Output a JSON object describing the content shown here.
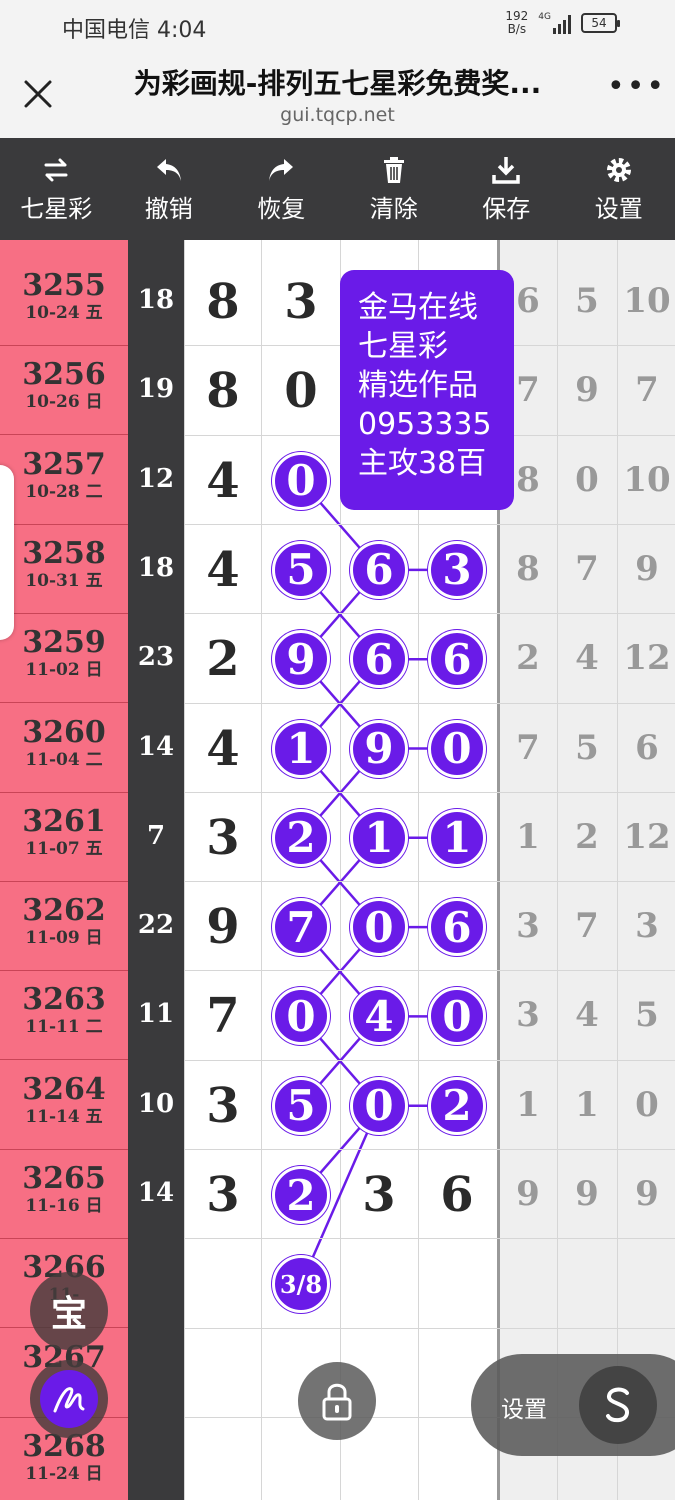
{
  "status_bar": {
    "carrier_time": "中国电信 4:04",
    "net_speed_value": "192",
    "net_speed_unit": "B/s",
    "network": "4G",
    "battery": "54"
  },
  "browser": {
    "title": "为彩画规-排列五七星彩免费奖...",
    "url": "gui.tqcp.net",
    "more": "•••"
  },
  "toolbar": {
    "mode": "七星彩",
    "undo": "撤销",
    "redo": "恢复",
    "clear": "清除",
    "save": "保存",
    "settings": "设置"
  },
  "rows": [
    {
      "issue": "3255",
      "date": "10-24 五",
      "sum": "18",
      "d1": "8",
      "d2": "3",
      "g1": "6",
      "g2": "5",
      "g3": "10"
    },
    {
      "issue": "3256",
      "date": "10-26 日",
      "sum": "19",
      "d1": "8",
      "d2": "0",
      "g1": "7",
      "g2": "9",
      "g3": "7"
    },
    {
      "issue": "3257",
      "date": "10-28 二",
      "sum": "12",
      "d1": "4",
      "b2": "0",
      "g1": "8",
      "g2": "0",
      "g3": "10"
    },
    {
      "issue": "3258",
      "date": "10-31 五",
      "sum": "18",
      "d1": "4",
      "b2": "5",
      "b3": "6",
      "b4": "3",
      "g1": "8",
      "g2": "7",
      "g3": "9"
    },
    {
      "issue": "3259",
      "date": "11-02 日",
      "sum": "23",
      "d1": "2",
      "b2": "9",
      "b3": "6",
      "b4": "6",
      "g1": "2",
      "g2": "4",
      "g3": "12"
    },
    {
      "issue": "3260",
      "date": "11-04 二",
      "sum": "14",
      "d1": "4",
      "b2": "1",
      "b3": "9",
      "b4": "0",
      "g1": "7",
      "g2": "5",
      "g3": "6"
    },
    {
      "issue": "3261",
      "date": "11-07 五",
      "sum": "7",
      "d1": "3",
      "b2": "2",
      "b3": "1",
      "b4": "1",
      "g1": "1",
      "g2": "2",
      "g3": "12"
    },
    {
      "issue": "3262",
      "date": "11-09 日",
      "sum": "22",
      "d1": "9",
      "b2": "7",
      "b3": "0",
      "b4": "6",
      "g1": "3",
      "g2": "7",
      "g3": "3"
    },
    {
      "issue": "3263",
      "date": "11-11 二",
      "sum": "11",
      "d1": "7",
      "b2": "0",
      "b3": "4",
      "b4": "0",
      "g1": "3",
      "g2": "4",
      "g3": "5"
    },
    {
      "issue": "3264",
      "date": "11-14 五",
      "sum": "10",
      "d1": "3",
      "b2": "5",
      "b3": "0",
      "b4": "2",
      "g1": "1",
      "g2": "1",
      "g3": "0"
    },
    {
      "issue": "3265",
      "date": "11-16 日",
      "sum": "14",
      "d1": "3",
      "b2": "2",
      "d3": "3",
      "d4": "6",
      "g1": "9",
      "g2": "9",
      "g3": "9"
    },
    {
      "issue": "3266",
      "date": "11-",
      "b2": "3/8"
    },
    {
      "issue": "3267",
      "date": "11-"
    },
    {
      "issue": "3268",
      "date": "11-24 日"
    }
  ],
  "promo": {
    "line1": "金马在线",
    "line2": "七星彩",
    "line3": "精选作品",
    "line4": "0953335",
    "line5": "主攻38百"
  },
  "floating": {
    "bao": "宝",
    "settings_label": "设置"
  },
  "colors": {
    "ball": "#6a1be8",
    "issue_column": "#f76f84",
    "toolbar": "#3a3a3c"
  }
}
